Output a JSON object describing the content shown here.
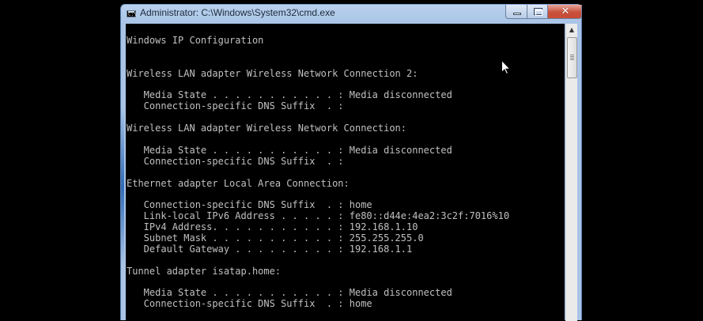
{
  "window": {
    "title": "Administrator: C:\\Windows\\System32\\cmd.exe",
    "icon": "cmd-icon",
    "controls": {
      "minimize": "minimize-icon",
      "maximize": "maximize-icon",
      "close": "close-icon",
      "close_glyph": "✕"
    }
  },
  "console": {
    "lines": [
      "Windows IP Configuration",
      "",
      "",
      "Wireless LAN adapter Wireless Network Connection 2:",
      "",
      "   Media State . . . . . . . . . . . : Media disconnected",
      "   Connection-specific DNS Suffix  . :",
      "",
      "Wireless LAN adapter Wireless Network Connection:",
      "",
      "   Media State . . . . . . . . . . . : Media disconnected",
      "   Connection-specific DNS Suffix  . :",
      "",
      "Ethernet adapter Local Area Connection:",
      "",
      "   Connection-specific DNS Suffix  . : home",
      "   Link-local IPv6 Address . . . . . : fe80::d44e:4ea2:3c2f:7016%10",
      "   IPv4 Address. . . . . . . . . . . : 192.168.1.10",
      "   Subnet Mask . . . . . . . . . . . : 255.255.255.0",
      "   Default Gateway . . . . . . . . . : 192.168.1.1",
      "",
      "Tunnel adapter isatap.home:",
      "",
      "   Media State . . . . . . . . . . . : Media disconnected",
      "   Connection-specific DNS Suffix  . : home"
    ]
  },
  "scrollbar": {
    "up_arrow_icon": "scroll-up-arrow-icon",
    "up_glyph": "▲"
  },
  "pointer": {
    "icon": "mouse-pointer-icon"
  },
  "colors": {
    "console_bg": "#000000",
    "console_text": "#c0c0c0",
    "frame": "#a9c4e6",
    "close_button": "#c94a34"
  }
}
